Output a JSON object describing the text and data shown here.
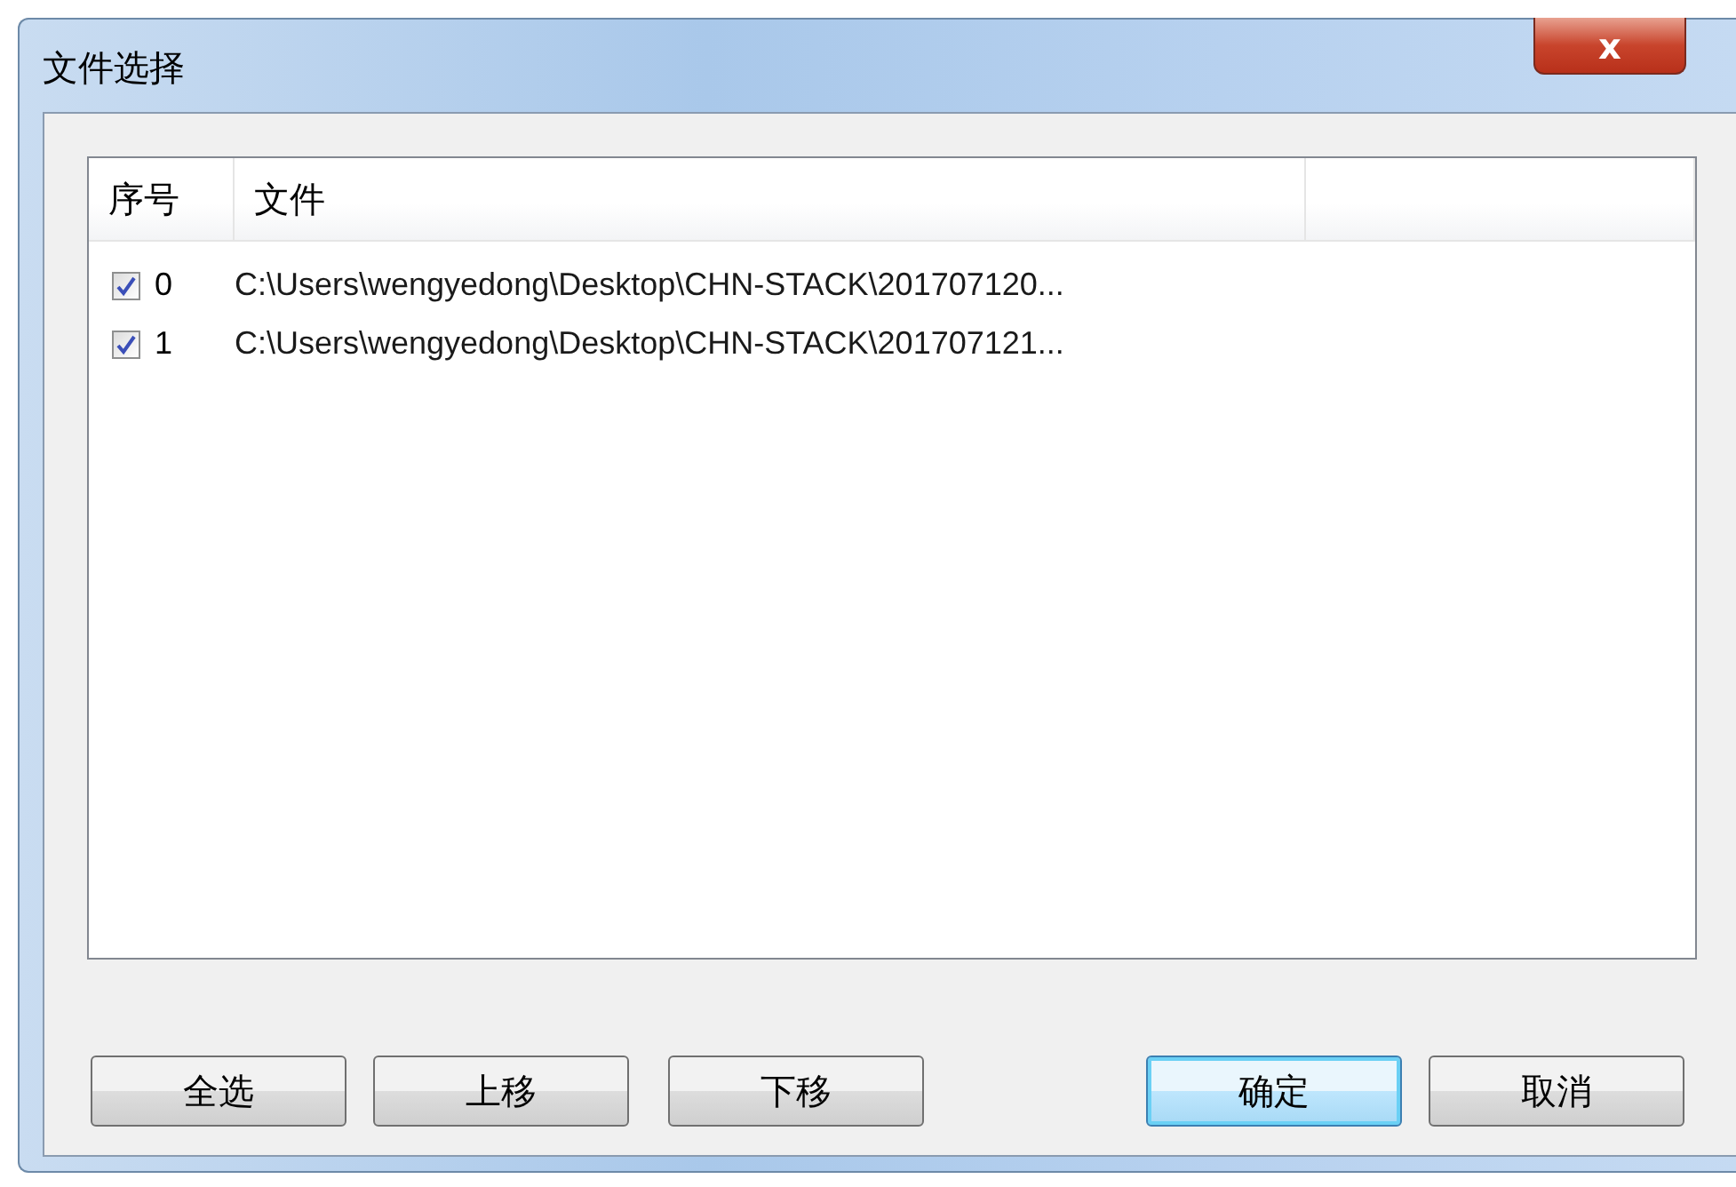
{
  "window": {
    "title": "文件选择",
    "close": "x"
  },
  "table": {
    "columns": [
      "序号",
      "文件"
    ],
    "rows": [
      {
        "checked": true,
        "index": "0",
        "file": "C:\\Users\\wengyedong\\Desktop\\CHN-STACK\\201707120..."
      },
      {
        "checked": true,
        "index": "1",
        "file": "C:\\Users\\wengyedong\\Desktop\\CHN-STACK\\201707121..."
      }
    ]
  },
  "buttons": [
    {
      "label": "全选",
      "default": false
    },
    {
      "label": "上移",
      "default": false
    },
    {
      "label": "下移",
      "default": false
    },
    {
      "label": "确定",
      "default": true
    },
    {
      "label": "取消",
      "default": false
    }
  ]
}
